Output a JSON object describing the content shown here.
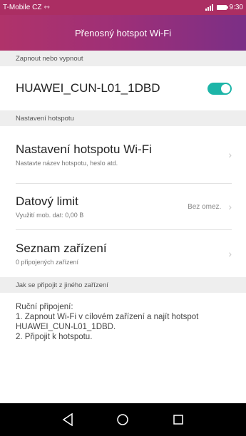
{
  "status_bar": {
    "carrier": "T-Mobile CZ",
    "time": "9:30"
  },
  "header": {
    "title": "Přenosný hotspot Wi-Fi"
  },
  "sections": {
    "toggle_section": "Zapnout nebo vypnout",
    "settings_section": "Nastavení hotspotu",
    "connect_section": "Jak se připojit z jiného zařízení"
  },
  "hotspot": {
    "ssid": "HUAWEI_CUN-L01_1DBD",
    "enabled": true
  },
  "settings": {
    "wifi_settings": {
      "title": "Nastavení hotspotu Wi-Fi",
      "subtitle": "Nastavte název hotspotu, heslo atd."
    },
    "data_limit": {
      "title": "Datový limit",
      "subtitle": "Využití mob. dat: 0,00 B",
      "value": "Bez omez."
    },
    "devices": {
      "title": "Seznam zařízení",
      "subtitle": "0 připojených zařízení"
    }
  },
  "help": {
    "line1": "Ruční připojení:",
    "line2": "1. Zapnout Wi-Fi v cílovém zařízení a najít hotspot HUAWEI_CUN-L01_1DBD.",
    "line3": "2. Připojit k hotspotu."
  },
  "colors": {
    "accent_toggle": "#1db5a8",
    "header_start": "#b0336a",
    "header_end": "#7b2f86"
  },
  "icons": {
    "back": "back-triangle-icon",
    "home": "home-circle-icon",
    "recents": "recents-square-icon"
  }
}
